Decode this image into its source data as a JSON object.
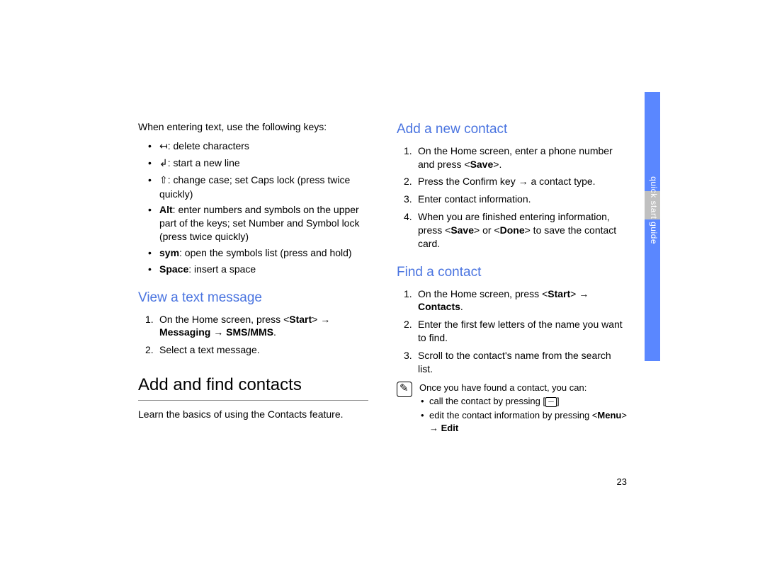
{
  "left": {
    "intro": "When entering text, use the following keys:",
    "keys": [
      {
        "pre_glyph": "↤",
        "text": ": delete characters"
      },
      {
        "pre_glyph": "↲",
        "text": ": start a new line"
      },
      {
        "pre_glyph": "⇧",
        "text": ": change case; set Caps lock (press twice quickly)"
      },
      {
        "bold": "Alt",
        "text": ": enter numbers and symbols on the upper part of the keys; set Number and Symbol lock (press twice quickly)"
      },
      {
        "bold": "sym",
        "text": ": open the symbols list (press and hold)"
      },
      {
        "bold": "Space",
        "text": ": insert a space"
      }
    ],
    "h_view": "View a text message",
    "view_steps": [
      {
        "t1": "On the Home screen, press <",
        "b1": "Start",
        "t2": "> → ",
        "b2": "Messaging",
        "t3": " → ",
        "b3": "SMS/MMS",
        "t4": "."
      },
      {
        "t1": "Select a text message."
      }
    ],
    "h_add": "Add and find contacts",
    "learn": "Learn the basics of using the Contacts feature."
  },
  "right": {
    "h_new": "Add a new contact",
    "new_steps": [
      {
        "t1": "On the Home screen, enter a phone number and press <",
        "b1": "Save",
        "t2": ">."
      },
      {
        "t1": "Press the Confirm key → a contact type."
      },
      {
        "t1": "Enter contact information."
      },
      {
        "t1": "When you are finished entering information, press <",
        "b1": "Save",
        "t2": "> or <",
        "b2": "Done",
        "t3": "> to save the contact card."
      }
    ],
    "h_find": "Find a contact",
    "find_steps": [
      {
        "t1": "On the Home screen, press <",
        "b1": "Start",
        "t2": "> → ",
        "b2": "Contacts",
        "t3": "."
      },
      {
        "t1": "Enter the first few letters of the name you want to find."
      },
      {
        "t1": "Scroll to the contact's name from the search list."
      }
    ],
    "note_head": "Once you have found a contact, you can:",
    "note_call": "call the contact by pressing [",
    "note_call_end": "]",
    "note_edit_t1": "edit the contact information by pressing <",
    "note_edit_b1": "Menu",
    "note_edit_t2": "> → ",
    "note_edit_b2": "Edit"
  },
  "side_label": "quick start guide",
  "page_number": "23"
}
